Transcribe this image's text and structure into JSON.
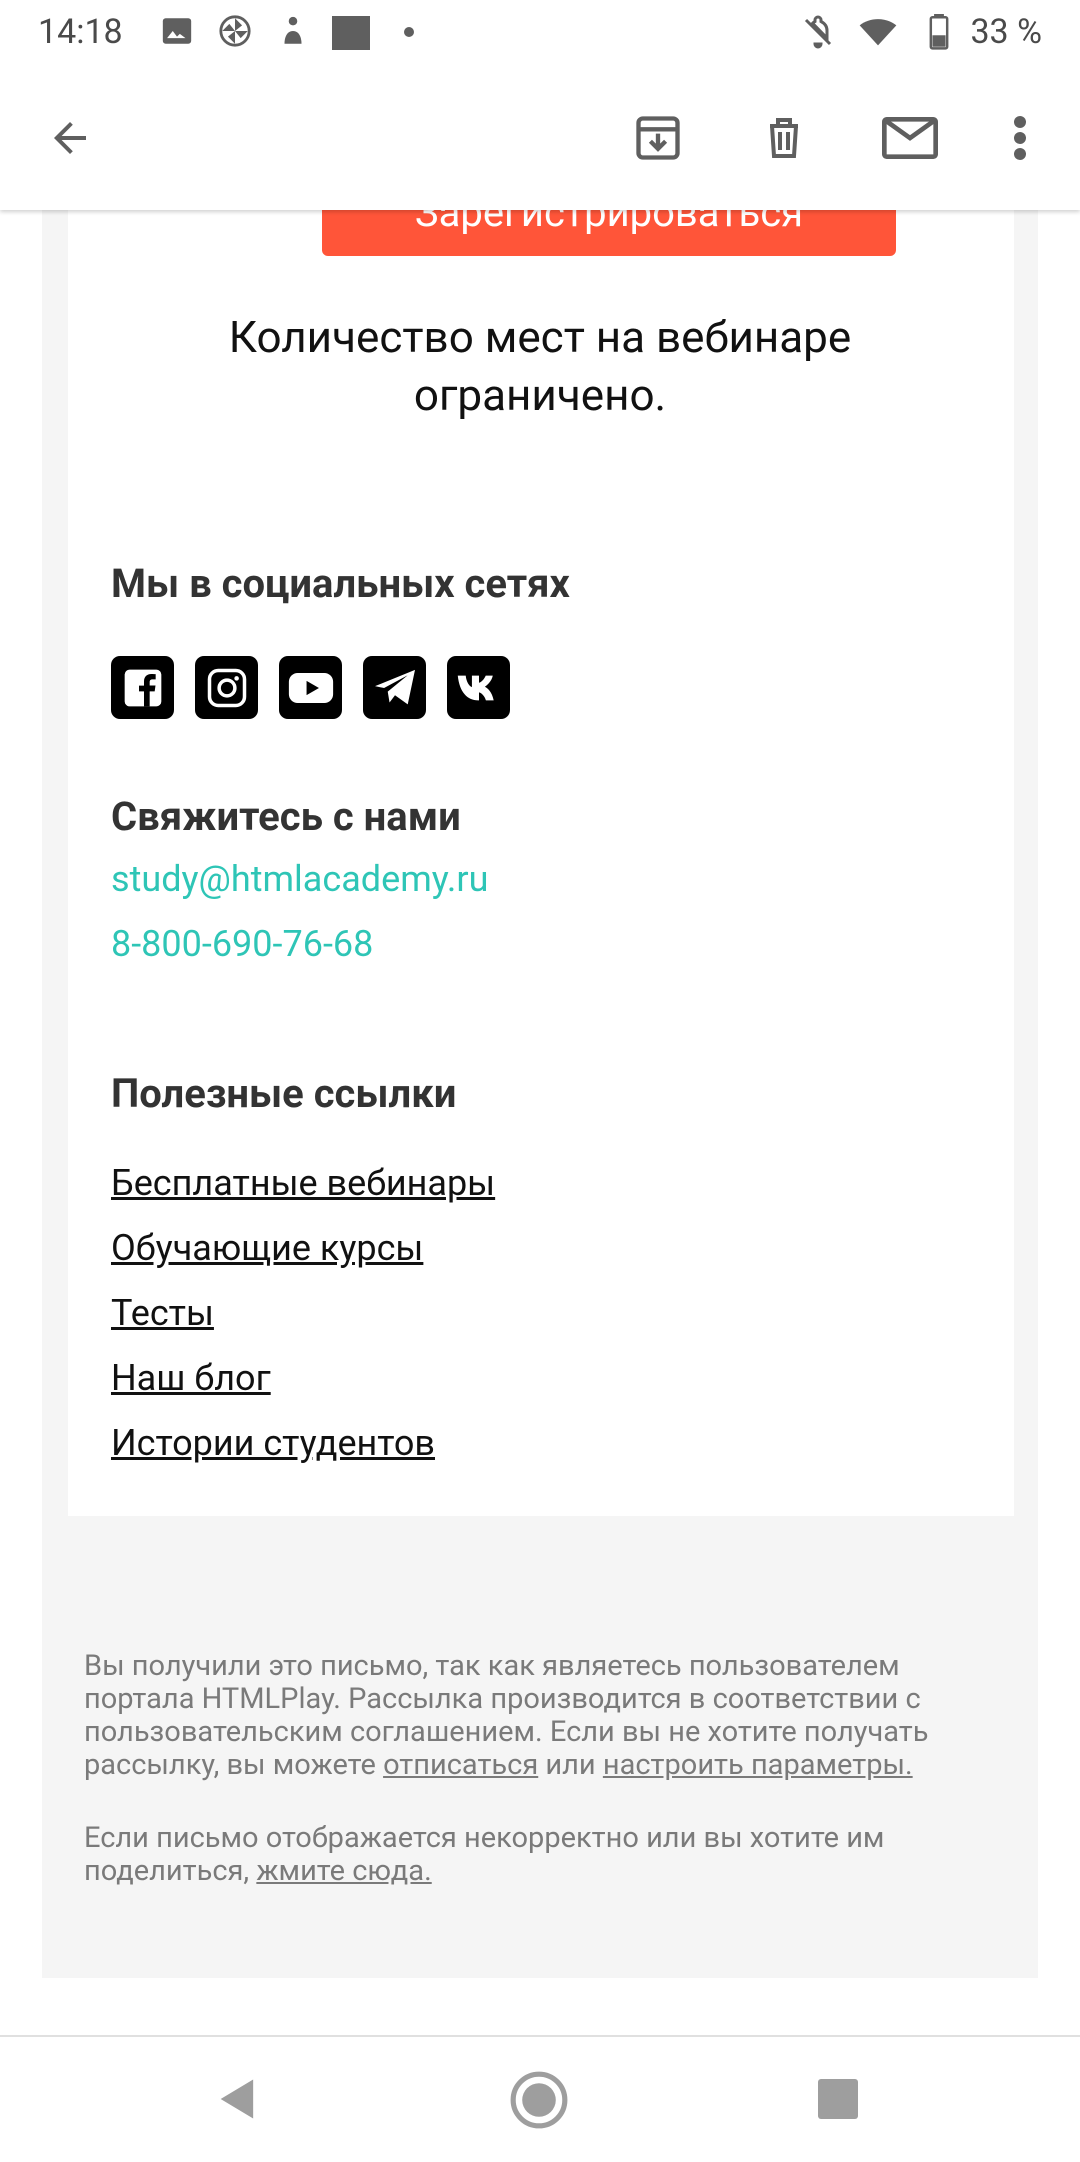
{
  "status_bar": {
    "time": "14:18",
    "battery": "33 %",
    "icons": [
      "image-icon",
      "pinwheel-icon",
      "figure-icon",
      "square-icon",
      "dot-icon",
      "bell-off-icon",
      "wifi-icon",
      "battery-icon"
    ]
  },
  "app_bar": {
    "icons": [
      "back-arrow-icon",
      "archive-icon",
      "trash-icon",
      "mail-icon",
      "more-vert-icon"
    ]
  },
  "email": {
    "cta_label": "Зарегистрироваться",
    "limit_text_line1": "Количество мест на вебинаре",
    "limit_text_line2": "ограничено.",
    "social_heading": "Мы в социальных сетях",
    "social_icons": [
      "facebook-icon",
      "instagram-icon",
      "youtube-icon",
      "telegram-icon",
      "vk-icon"
    ],
    "contact_heading": "Свяжитесь с нами",
    "email": "study@htmlacademy.ru",
    "phone": "8-800-690-76-68",
    "links_heading": "Полезные ссылки",
    "links": [
      "Бесплатные вебинары",
      "Обучающие курсы",
      "Тесты",
      "Наш блог",
      "Истории студентов"
    ]
  },
  "footer": {
    "p1_text": "Вы получили это письмо, так как являетесь пользователем портала HTMLPlay. Рассылка производится в соответствии с пользовательским соглашением. Если вы не хотите получать рассылку, вы можете ",
    "p1_link1": "отписаться",
    "p1_or": " или ",
    "p1_link2": "настроить параметры.",
    "p2_text": "Если письмо отображается некорректно или вы хотите им поделиться, ",
    "p2_link": "жмите сюда."
  },
  "colors": {
    "accent": "#ff5539",
    "link_teal": "#2ec5b6",
    "footer_bg": "#f5f5f5"
  }
}
